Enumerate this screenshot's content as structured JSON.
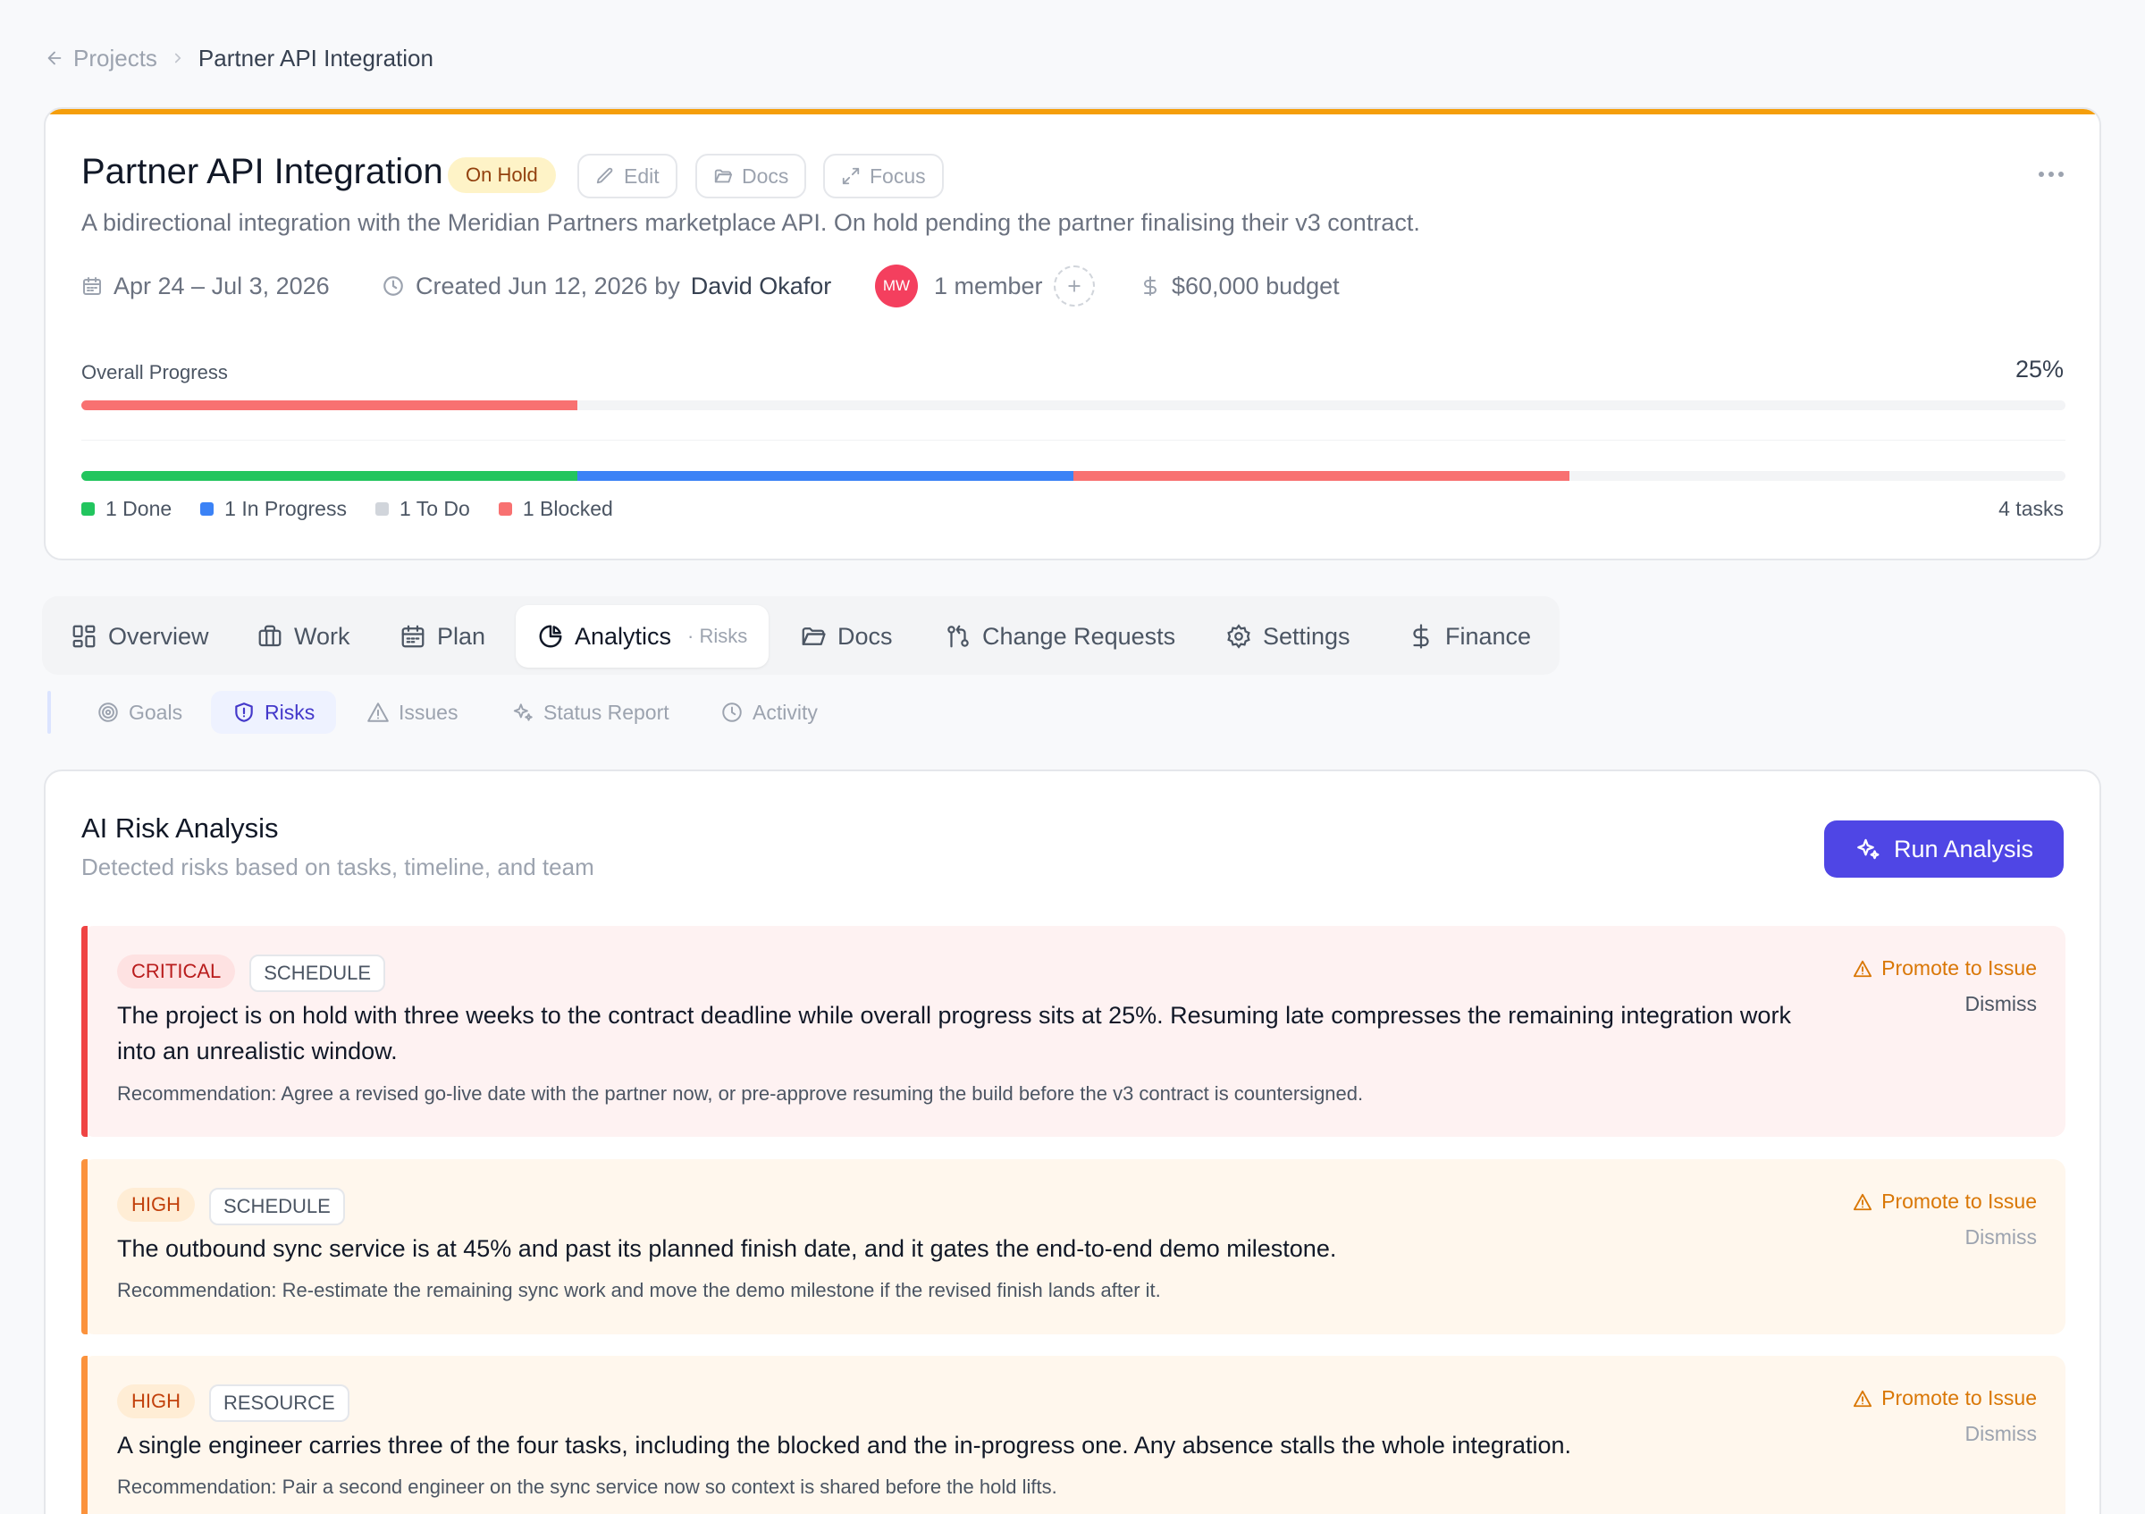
{
  "breadcrumb": {
    "parent": "Projects",
    "current": "Partner API Integration"
  },
  "project": {
    "title": "Partner API Integration",
    "status": "On Hold",
    "actions": {
      "edit": "Edit",
      "docs": "Docs",
      "focus": "Focus"
    },
    "description": "A bidirectional integration with the Meridian Partners marketplace API. On hold pending the partner finalising their v3 contract.",
    "dates": "Apr 24 – Jul 3, 2026",
    "created_prefix": "Created Jun 12, 2026 by",
    "created_by": "David Okafor",
    "avatar_initials": "MW",
    "members": "1 member",
    "budget": "$60,000 budget",
    "progress_label": "Overall Progress",
    "progress_pct": "25%",
    "progress_value": 0.25,
    "status_breakdown": [
      {
        "label": "1 Done",
        "count": 1,
        "color": "#22c55e"
      },
      {
        "label": "1 In Progress",
        "count": 1,
        "color": "#3b82f6"
      },
      {
        "label": "1 To Do",
        "count": 1,
        "color": "#d1d5db"
      },
      {
        "label": "1 Blocked",
        "count": 1,
        "color": "#f87171"
      }
    ],
    "tasks_total": "4 tasks",
    "accent_color": "#f59e0b"
  },
  "tabs": [
    {
      "label": "Overview",
      "icon": "layout-grid-icon"
    },
    {
      "label": "Work",
      "icon": "briefcase-icon"
    },
    {
      "label": "Plan",
      "icon": "calendar-icon"
    },
    {
      "label": "Analytics",
      "icon": "pie-chart-icon",
      "sub": "· Risks",
      "active": true
    },
    {
      "label": "Docs",
      "icon": "folder-open-icon"
    },
    {
      "label": "Change Requests",
      "icon": "git-pull-request-icon"
    },
    {
      "label": "Settings",
      "icon": "gear-icon"
    },
    {
      "label": "Finance",
      "icon": "dollar-icon"
    }
  ],
  "subtabs": [
    {
      "label": "Goals",
      "icon": "target-icon"
    },
    {
      "label": "Risks",
      "icon": "shield-icon",
      "active": true
    },
    {
      "label": "Issues",
      "icon": "warning-icon"
    },
    {
      "label": "Status Report",
      "icon": "sparkles-icon"
    },
    {
      "label": "Activity",
      "icon": "clock-icon"
    }
  ],
  "risk_panel": {
    "title": "AI Risk Analysis",
    "subtitle": "Detected risks based on tasks, timeline, and team",
    "run_label": "Run Analysis",
    "promote_label": "Promote to Issue",
    "dismiss_label": "Dismiss",
    "risks": [
      {
        "severity": "CRITICAL",
        "category": "SCHEDULE",
        "text": "The project is on hold with three weeks to the contract deadline while overall progress sits at 25%. Resuming late compresses the remaining integration work into an unrealistic window.",
        "recommendation": "Recommendation: Agree a revised go-live date with the partner now, or pre-approve resuming the build before the v3 contract is countersigned."
      },
      {
        "severity": "HIGH",
        "category": "SCHEDULE",
        "text": "The outbound sync service is at 45% and past its planned finish date, and it gates the end-to-end demo milestone.",
        "recommendation": "Recommendation: Re-estimate the remaining sync work and move the demo milestone if the revised finish lands after it."
      },
      {
        "severity": "HIGH",
        "category": "RESOURCE",
        "text": "A single engineer carries three of the four tasks, including the blocked and the in-progress one. Any absence stalls the whole integration.",
        "recommendation": "Recommendation: Pair a second engineer on the sync service now so context is shared before the hold lifts."
      }
    ]
  }
}
